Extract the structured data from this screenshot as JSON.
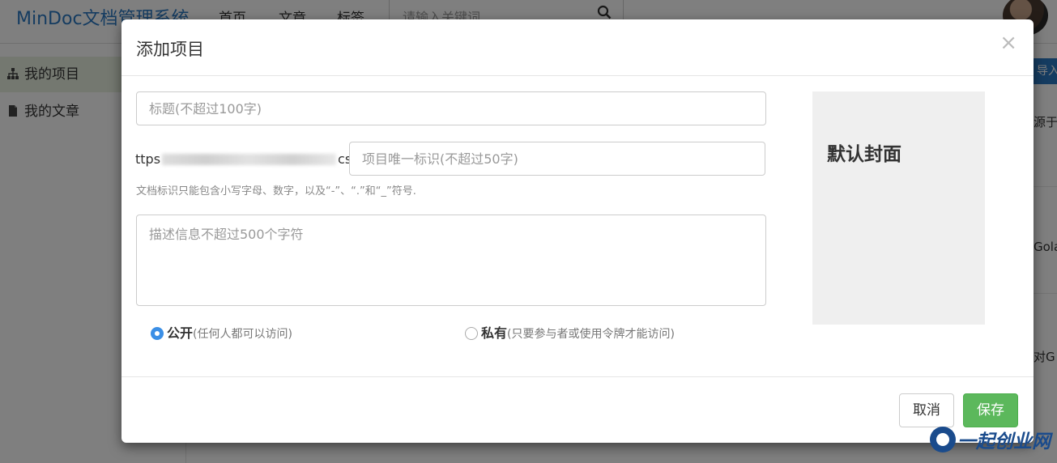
{
  "app": {
    "brand": "MinDoc文档管理系统",
    "nav": [
      "首页",
      "文章",
      "标签"
    ],
    "search_placeholder": "请输入关键词..."
  },
  "sidebar": {
    "items": [
      {
        "label": "我的项目",
        "active": true
      },
      {
        "label": "我的文章",
        "active": false
      }
    ]
  },
  "background_right": {
    "import_label": "导入",
    "snippets": [
      "源于",
      "Gola",
      "对G"
    ]
  },
  "modal": {
    "title": "添加项目",
    "close_glyph": "×",
    "title_placeholder": "标题(不超过100字)",
    "url_prefix_start": "ttps",
    "url_prefix_end": "cs/",
    "identifier_placeholder": "项目唯一标识(不超过50字)",
    "identifier_help": "文档标识只能包含小写字母、数字，以及“-”、“.”和“_”符号.",
    "description_placeholder": "描述信息不超过500个字符",
    "cover_label": "默认封面",
    "visibility": {
      "public_label": "公开",
      "public_hint": "(任何人都可以访问)",
      "private_label": "私有",
      "private_hint": "(只要参与者或使用令牌才能访问)",
      "selected": "public"
    },
    "cancel_label": "取消",
    "save_label": "保存"
  },
  "watermark": {
    "text": "一起创业网"
  },
  "colors": {
    "brand_blue": "#2b78c2",
    "save_green": "#5cb85c",
    "radio_blue": "#3b8fe6"
  }
}
